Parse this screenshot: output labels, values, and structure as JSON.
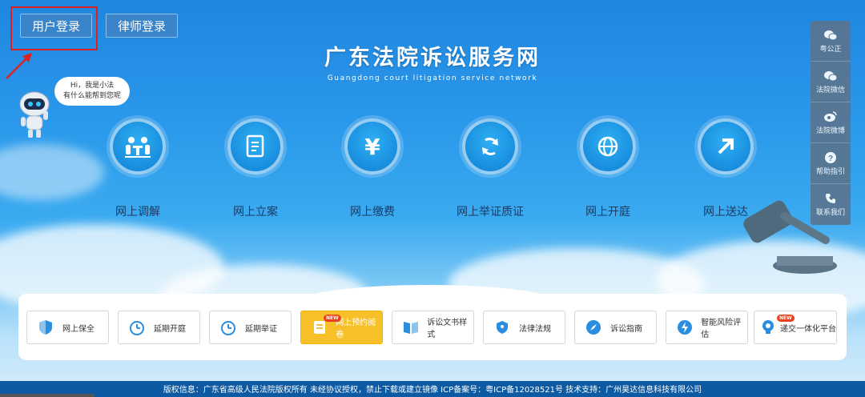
{
  "header": {
    "user_login": "用户登录",
    "lawyer_login": "律师登录",
    "title_cn": "广东法院诉讼服务网",
    "title_en": "Guangdong court litigation service network"
  },
  "assistant": {
    "line1": "Hi，我是小法",
    "line2": "有什么能帮到您呢"
  },
  "services": [
    {
      "label": "网上调解",
      "icon": "people-table-icon"
    },
    {
      "label": "网上立案",
      "icon": "document-edit-icon"
    },
    {
      "label": "网上缴费",
      "icon": "yuan-icon"
    },
    {
      "label": "网上举证质证",
      "icon": "exchange-icon"
    },
    {
      "label": "网上开庭",
      "icon": "globe-icon"
    },
    {
      "label": "网上送达",
      "icon": "arrow-up-right-icon"
    }
  ],
  "sidebar": [
    {
      "label": "粤公正",
      "icon": "wechat-icon"
    },
    {
      "label": "法院微信",
      "icon": "wechat-icon"
    },
    {
      "label": "法院微博",
      "icon": "weibo-icon"
    },
    {
      "label": "帮助指引",
      "icon": "help-icon"
    },
    {
      "label": "联系我们",
      "icon": "phone-icon"
    }
  ],
  "quick_links": [
    {
      "label": "网上保全",
      "icon": "shield-icon"
    },
    {
      "label": "延期开庭",
      "icon": "clock-icon"
    },
    {
      "label": "延期举证",
      "icon": "clock-icon"
    },
    {
      "label": "网上预约阅卷",
      "icon": "document-icon",
      "badge": "NEW"
    },
    {
      "label": "诉讼文书样式",
      "icon": "book-icon"
    },
    {
      "label": "法律法规",
      "icon": "shield-icon"
    },
    {
      "label": "诉讼指南",
      "icon": "compass-icon"
    },
    {
      "label": "智能风险评估",
      "icon": "bolt-icon"
    },
    {
      "label": "递交一体化平台",
      "icon": "lightbulb-icon",
      "badge": "NEW"
    }
  ],
  "footer": {
    "text": "版权信息：广东省高级人民法院版权所有  未经协议授权，禁止下载或建立镜像 ICP备案号：粤ICP备12028521号 技术支持：广州昊达信息科技有限公司"
  },
  "colors": {
    "primary": "#1f86e0",
    "highlight_red": "#e02020",
    "featured_yellow": "#f7c028"
  }
}
